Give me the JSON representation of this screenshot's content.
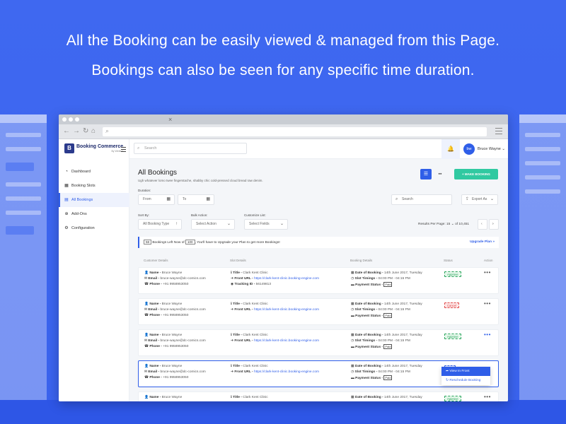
{
  "headline": {
    "line1": "All the Booking can be easily viewed & managed from this Page.",
    "line2": "Bookings can also be seen for any specific time duration."
  },
  "browser": {
    "tab_close_icon": "×",
    "nav_icons": [
      "back-icon",
      "forward-icon",
      "reload-icon",
      "home-icon"
    ]
  },
  "sidebar": {
    "logo_name": "Booking Commerce",
    "logo_sub": "By Webkul",
    "items": [
      {
        "label": "Dashboard",
        "icon": "gauge-icon"
      },
      {
        "label": "Booking Slots",
        "icon": "calendar-icon"
      },
      {
        "label": "All Bookings",
        "icon": "document-icon",
        "active": true
      },
      {
        "label": "Add-Ons",
        "icon": "plus-circle-icon"
      },
      {
        "label": "Configuration",
        "icon": "gear-icon"
      }
    ]
  },
  "topbar": {
    "search_placeholder": "Search",
    "avatar_initials": "bw",
    "user_name": "Bruce Wayne"
  },
  "page": {
    "title": "All Bookings",
    "subtitle": "Ugh whatever lomo twee fingerstache, shabby chic cold-pressed cloud bread raw denim.",
    "make_booking": "+ MAKE BOOKING"
  },
  "filters": {
    "duration_label": "Duration:",
    "from_placeholder": "From",
    "to_placeholder": "To",
    "search_placeholder": "Search",
    "export_label": "Export As",
    "sort_label": "Sort By:",
    "sort_value": "All Booking Type",
    "bulk_label": "Bulk Action:",
    "bulk_value": "Select Action",
    "customize_label": "Customize List:",
    "customize_value": "Select Fields",
    "results_label": "Results Per Page:",
    "results_value": "15",
    "results_of": "of 10,451"
  },
  "notice": {
    "count": "58",
    "text_pre": "Bookings Left Now of",
    "limit": "100",
    "text_post": ", You'll have to Upgrade your Plan to get more Bookings!",
    "upgrade": "Upgrade Plan »"
  },
  "table": {
    "headers": {
      "customer": "Customer Details",
      "slot": "Slot Details",
      "booking": "Booking Details",
      "status": "Status",
      "action": "Action"
    },
    "keys": {
      "name": "Name -",
      "email": "Email -",
      "phone": "Phone -",
      "title": "Title -",
      "front_url": "Front URL -",
      "tracking": "Tracking ID -",
      "date": "Date of Booking -",
      "timings": "Slot Timings -",
      "payment": "Payment Status -"
    },
    "rows": [
      {
        "name": "Bruce Wayne",
        "email": "bruce-wayne@dc-comics.com",
        "phone": "+91 9958953050",
        "title": "Clark Kent Clinic",
        "url": "https://clark-kent-clinic.booking-engine.com",
        "tracking": "56149813",
        "date": "14th June 2017, Tuesday",
        "timings": "04:00 PM - 04:15 PM",
        "payment": "Paid",
        "status": "Approve",
        "status_type": "approve"
      },
      {
        "name": "Bruce Wayne",
        "email": "bruce-wayne@dc-comics.com",
        "phone": "+91 9958953050",
        "title": "Clark Kent Clinic",
        "url": "https://clark-kent-clinic.booking-engine.com",
        "date": "14th June 2017, Tuesday",
        "timings": "04:00 PM - 04:15 PM",
        "payment": "Paid",
        "status": "Cancel",
        "status_type": "cancel"
      },
      {
        "name": "Bruce Wayne",
        "email": "bruce-wayne@dc-comics.com",
        "phone": "+91 9958953050",
        "title": "Clark Kent Clinic",
        "url": "https://clark-kent-clinic.booking-engine.com",
        "date": "14th June 2017, Tuesday",
        "timings": "04:00 PM - 04:15 PM",
        "payment": "Paid",
        "status": "Approve",
        "status_type": "approve"
      },
      {
        "name": "Bruce Wayne",
        "email": "bruce-wayne@dc-comics.com",
        "phone": "+91 9958953050",
        "title": "Clark Kent Clinic",
        "url": "https://clark-kent-clinic.booking-engine.com",
        "date": "14th June 2017, Tuesday",
        "timings": "04:00 PM - 04:15 PM",
        "payment": "Paid",
        "status": "New",
        "status_type": "new"
      },
      {
        "name": "Bruce Wayne",
        "title": "Clark Kent Clinic",
        "date": "14th June 2017, Tuesday",
        "status": "Approve",
        "status_type": "approve"
      }
    ]
  },
  "row_menu": {
    "view": "View In Front",
    "reschedule": "Reschedule Booking"
  },
  "colors": {
    "background": "#3f68f0",
    "accent": "#2f5ee8",
    "make_booking": "#30c9a1",
    "approve": "#27a35a",
    "cancel": "#e04848"
  }
}
